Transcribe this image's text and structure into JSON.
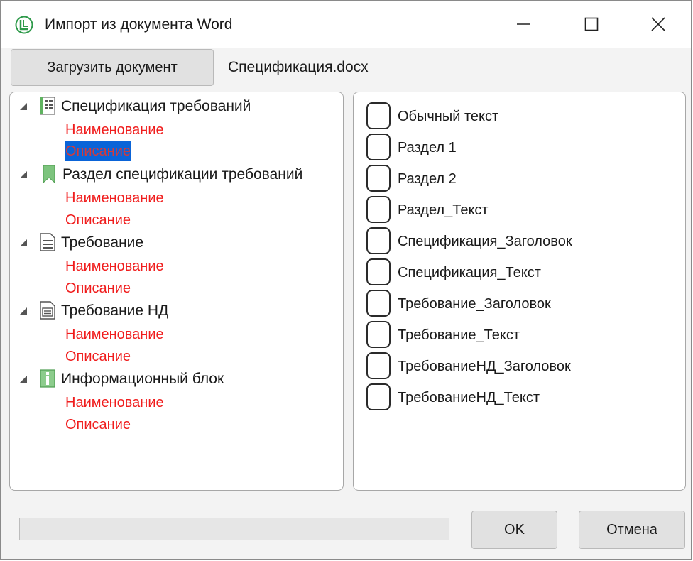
{
  "window": {
    "title": "Импорт из документа Word"
  },
  "toolbar": {
    "load_label": "Загрузить документ",
    "filename": "Спецификация.docx"
  },
  "tree": {
    "nodes": [
      {
        "label": "Спецификация требований",
        "icon": "spec-grid-icon",
        "children": [
          "Наименование",
          "Описание"
        ]
      },
      {
        "label": "Раздел спецификации требований",
        "icon": "bookmark-icon",
        "children": [
          "Наименование",
          "Описание"
        ]
      },
      {
        "label": "Требование",
        "icon": "requirement-doc-icon",
        "children": [
          "Наименование",
          "Описание"
        ]
      },
      {
        "label": "Требование НД",
        "icon": "requirement-nd-icon",
        "children": [
          "Наименование",
          "Описание"
        ]
      },
      {
        "label": "Информационный блок",
        "icon": "info-block-icon",
        "children": [
          "Наименование",
          "Описание"
        ]
      }
    ],
    "selected": "0.1"
  },
  "styles": [
    {
      "label": "Обычный текст",
      "checked": false
    },
    {
      "label": "Раздел 1",
      "checked": false
    },
    {
      "label": "Раздел 2",
      "checked": false
    },
    {
      "label": "Раздел_Текст",
      "checked": false
    },
    {
      "label": "Спецификация_Заголовок",
      "checked": false
    },
    {
      "label": "Спецификация_Текст",
      "checked": false
    },
    {
      "label": "Требование_Заголовок",
      "checked": false
    },
    {
      "label": "Требование_Текст",
      "checked": false
    },
    {
      "label": "ТребованиеНД_Заголовок",
      "checked": false
    },
    {
      "label": "ТребованиеНД_Текст",
      "checked": false
    }
  ],
  "footer": {
    "progress": 0,
    "ok_label": "OK",
    "cancel_label": "Отмена"
  },
  "colors": {
    "field_label": "#f01d1d",
    "selection": "#0a64d8",
    "icon_green": "#5fb360"
  }
}
